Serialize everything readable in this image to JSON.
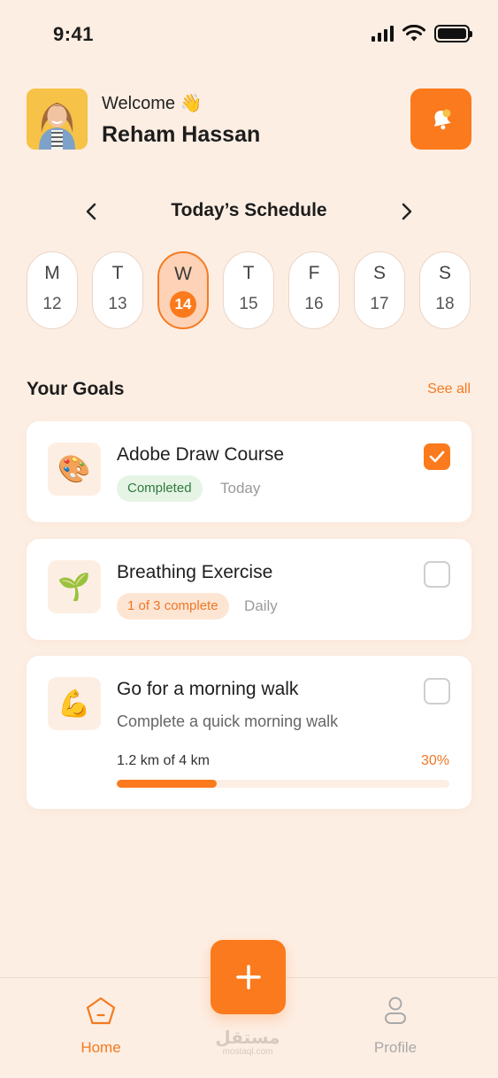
{
  "status_bar": {
    "time": "9:41"
  },
  "header": {
    "welcome": "Welcome 👋",
    "user_name": "Reham Hassan"
  },
  "schedule": {
    "title": "Today’s Schedule",
    "days": [
      {
        "name": "M",
        "num": "12",
        "active": false
      },
      {
        "name": "T",
        "num": "13",
        "active": false
      },
      {
        "name": "W",
        "num": "14",
        "active": true
      },
      {
        "name": "T",
        "num": "15",
        "active": false
      },
      {
        "name": "F",
        "num": "16",
        "active": false
      },
      {
        "name": "S",
        "num": "17",
        "active": false
      },
      {
        "name": "S",
        "num": "18",
        "active": false
      }
    ]
  },
  "goals": {
    "title": "Your Goals",
    "see_all": "See all",
    "items": [
      {
        "icon": "🎨",
        "icon_name": "palette-icon",
        "title": "Adobe Draw Course",
        "status": "Completed",
        "frequency": "Today",
        "checked": true
      },
      {
        "icon": "🌱",
        "icon_name": "seedling-icon",
        "title": "Breathing Exercise",
        "status": "1 of 3 complete",
        "frequency": "Daily",
        "checked": false
      },
      {
        "icon": "💪",
        "icon_name": "flexed-biceps-icon",
        "title": "Go for a morning walk",
        "subtitle": "Complete a quick morning walk",
        "progress_label": "1.2 km of 4 km",
        "progress_percent": "30%",
        "progress": 0.3,
        "checked": false
      }
    ]
  },
  "nav": {
    "home": "Home",
    "profile": "Profile"
  },
  "watermark": {
    "main": "مستقل",
    "sub": "mostaql.com"
  },
  "colors": {
    "accent": "#fb7a1d",
    "background": "#fdeee3",
    "success_bg": "#e6f4e6",
    "success_text": "#2f7a3a"
  }
}
